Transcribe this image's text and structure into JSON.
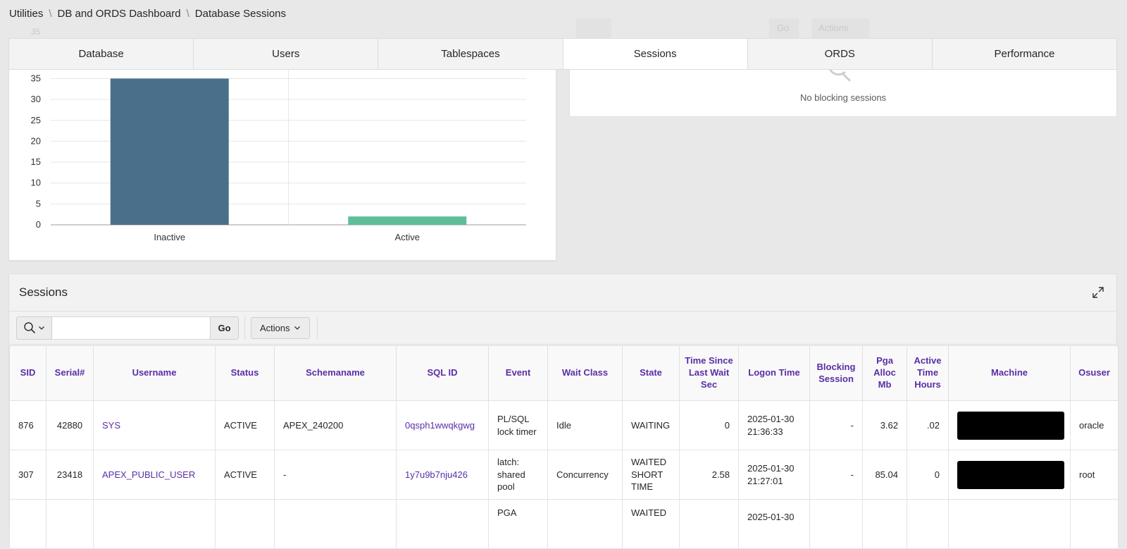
{
  "breadcrumb": {
    "items": [
      "Utilities",
      "DB and ORDS Dashboard"
    ],
    "current": "Database Sessions"
  },
  "tabs": [
    {
      "label": "Database",
      "active": false
    },
    {
      "label": "Users",
      "active": false
    },
    {
      "label": "Tablespaces",
      "active": false
    },
    {
      "label": "Sessions",
      "active": true
    },
    {
      "label": "ORDS",
      "active": false
    },
    {
      "label": "Performance",
      "active": false
    }
  ],
  "background_controls": {
    "go_label": "Go",
    "actions_label": "Actions",
    "axis_top_tick": "35"
  },
  "chart_data": {
    "type": "bar",
    "categories": [
      "Inactive",
      "Active"
    ],
    "values": [
      35,
      2
    ],
    "colors": [
      "#4a6f8a",
      "#5dbf98"
    ],
    "yticks": [
      0,
      5,
      10,
      15,
      20,
      25,
      30,
      35
    ],
    "ylim": [
      0,
      35
    ],
    "xlabel": "",
    "ylabel": "",
    "title": "",
    "grid": true
  },
  "blocking": {
    "message": "No blocking sessions"
  },
  "sessions": {
    "title": "Sessions",
    "search_placeholder": "",
    "go_label": "Go",
    "actions_label": "Actions",
    "columns": [
      "SID",
      "Serial#",
      "Username",
      "Status",
      "Schemaname",
      "SQL ID",
      "Event",
      "Wait Class",
      "State",
      "Time Since Last Wait Sec",
      "Logon Time",
      "Blocking Session",
      "Pga Alloc Mb",
      "Active Time Hours",
      "Machine",
      "Osuser"
    ],
    "rows": [
      {
        "sid": "876",
        "serial": "42880",
        "username": "SYS",
        "status": "ACTIVE",
        "schema": "APEX_240200",
        "sql_id": "0qsph1wwqkgwg",
        "event": "PL/SQL lock timer",
        "wait_class": "Idle",
        "state": "WAITING",
        "time_since": "0",
        "logon": "2025-01-30 21:36:33",
        "blocking": "-",
        "pga": "3.62",
        "active_hours": ".02",
        "osuser": "oracle"
      },
      {
        "sid": "307",
        "serial": "23418",
        "username": "APEX_PUBLIC_USER",
        "status": "ACTIVE",
        "schema": "-",
        "sql_id": "1y7u9b7nju426",
        "event": "latch: shared pool",
        "wait_class": "Concurrency",
        "state": "WAITED SHORT TIME",
        "time_since": "2.58",
        "logon": "2025-01-30 21:27:01",
        "blocking": "-",
        "pga": "85.04",
        "active_hours": "0",
        "osuser": "root"
      },
      {
        "sid": "",
        "serial": "",
        "username": "",
        "status": "",
        "schema": "",
        "sql_id": "",
        "event": "PGA",
        "wait_class": "",
        "state": "WAITED",
        "time_since": "",
        "logon": "2025-01-30",
        "blocking": "",
        "pga": "",
        "active_hours": "",
        "osuser": ""
      }
    ]
  }
}
